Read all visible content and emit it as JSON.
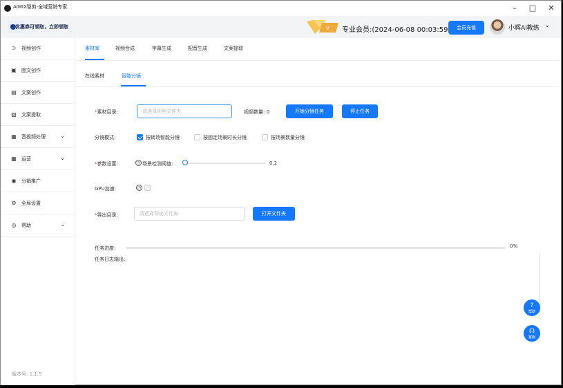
{
  "window": {
    "title": "AIMIX智剪-全域营销专家",
    "controls": {
      "minimize": "–",
      "maximize": "□",
      "close": "✕"
    }
  },
  "header": {
    "promo_text": "有优惠券可领取，立即领取",
    "membership_text": "专业会员:(2024-06-08 00:03:59)",
    "renew_button": "会员充值",
    "username": "小辉AI教练",
    "vip_badge_icon": "vip-crown-icon"
  },
  "sidebar": {
    "items": [
      {
        "label": "视频创作",
        "icon": "video-create-icon",
        "glyph": "⊃",
        "has_chevron": false
      },
      {
        "label": "图文创作",
        "icon": "image-text-icon",
        "glyph": "▣",
        "has_chevron": false
      },
      {
        "label": "文案创作",
        "icon": "doc-create-icon",
        "glyph": "▤",
        "has_chevron": false
      },
      {
        "label": "文案提取",
        "icon": "doc-extract-icon",
        "glyph": "▧",
        "has_chevron": false
      },
      {
        "label": "音视频处理",
        "icon": "av-process-icon",
        "glyph": "▦",
        "has_chevron": true
      },
      {
        "label": "运营",
        "icon": "operation-icon",
        "glyph": "▦",
        "has_chevron": true
      },
      {
        "label": "分销推广",
        "icon": "promotion-icon",
        "glyph": "◉",
        "has_chevron": false
      },
      {
        "label": "全局设置",
        "icon": "settings-icon",
        "glyph": "⚙",
        "has_chevron": false
      },
      {
        "label": "帮助",
        "icon": "help-icon",
        "glyph": "◎",
        "has_chevron": true
      }
    ],
    "version": "版本号: 1.1.5"
  },
  "tabs": {
    "primary": [
      "素材库",
      "视频合成",
      "字幕生成",
      "配音生成",
      "文案提取"
    ],
    "primary_active": 0,
    "secondary": [
      "在线素材",
      "智能分镜"
    ],
    "secondary_active": 1
  },
  "form": {
    "source_dir": {
      "label": "素材目录:",
      "placeholder": "请选择视频文件夹",
      "video_count_label": "视频数量: 0",
      "start_button": "开始分镜任务",
      "stop_button": "停止任务"
    },
    "split_mode": {
      "label": "分镜模式:",
      "options": [
        {
          "label": "按转场智能分镜",
          "checked": true
        },
        {
          "label": "按固定场景时长分镜",
          "checked": false
        },
        {
          "label": "按场景数量分镜",
          "checked": false
        }
      ]
    },
    "params": {
      "label": "参数设置:",
      "threshold_label": "场景检测阈值:",
      "threshold_value": "0.2"
    },
    "gpu": {
      "label": "GPU加速:",
      "checked": false
    },
    "export_dir": {
      "label": "导出目录:",
      "placeholder": "请选择导出文件夹",
      "open_button": "打开文件夹"
    }
  },
  "task": {
    "progress_label": "任务进度:",
    "progress_value": "0%",
    "progress_fraction": 0,
    "log_label": "任务日志输出:"
  },
  "float_buttons": {
    "help": {
      "label": "帮助",
      "icon": "question-icon"
    },
    "support": {
      "label": "客服",
      "icon": "headset-icon"
    }
  },
  "colors": {
    "accent": "#1677ff",
    "required": "#e53935",
    "promo_dot": "#1f58d6"
  }
}
